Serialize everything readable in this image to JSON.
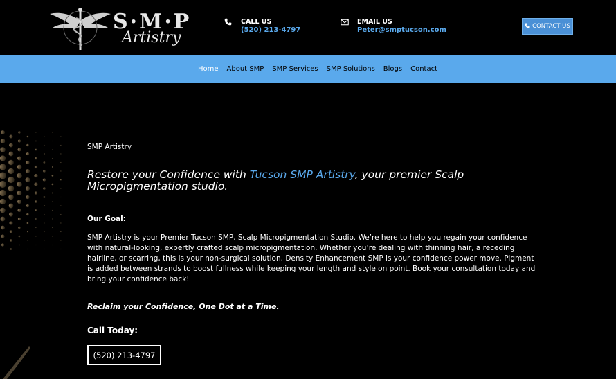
{
  "header": {
    "logo": {
      "brand_top": "S·M·P",
      "brand_script": "Artistry"
    },
    "call": {
      "label": "CALL US",
      "value": "(520) 213-4797"
    },
    "email": {
      "label": "EMAIL US",
      "value": "Peter@smptucson.com"
    },
    "contact_button": "CONTACT US"
  },
  "nav": {
    "items": [
      {
        "label": "Home",
        "active": true
      },
      {
        "label": "About SMP"
      },
      {
        "label": "SMP Services"
      },
      {
        "label": "SMP Solutions"
      },
      {
        "label": "Blogs"
      },
      {
        "label": "Contact"
      }
    ]
  },
  "main": {
    "brand_line": "SMP Artistry",
    "headline": {
      "before": "Restore your Confidence with ",
      "link": "Tucson SMP Artistry",
      "after": ", your premier Scalp Micropigmentation studio."
    },
    "goal_label": "Our Goal:",
    "goal_text": "SMP Artistry is your Premier Tucson SMP, Scalp Micropigmentation Studio. We’re here to help you regain your confidence with natural-looking, expertly crafted scalp micropigmentation. Whether you’re dealing with thinning hair, a receding hairline, or scarring, this is your non-surgical solution. Density Enhancement SMP is your confidence power move. Pigment is added between strands to boost fullness while keeping your length and style on point. Book your consultation today and bring your confidence back!",
    "tagline": "Reclaim your Confidence, One Dot at a Time.",
    "call_today": "Call Today:",
    "phone_button": "(520) 213-4797"
  },
  "colors": {
    "accent": "#5aa9ec",
    "background": "#000000",
    "button": "#4a90d6"
  },
  "icons": [
    "phone-icon",
    "email-icon",
    "logo-caduceus-icon"
  ]
}
